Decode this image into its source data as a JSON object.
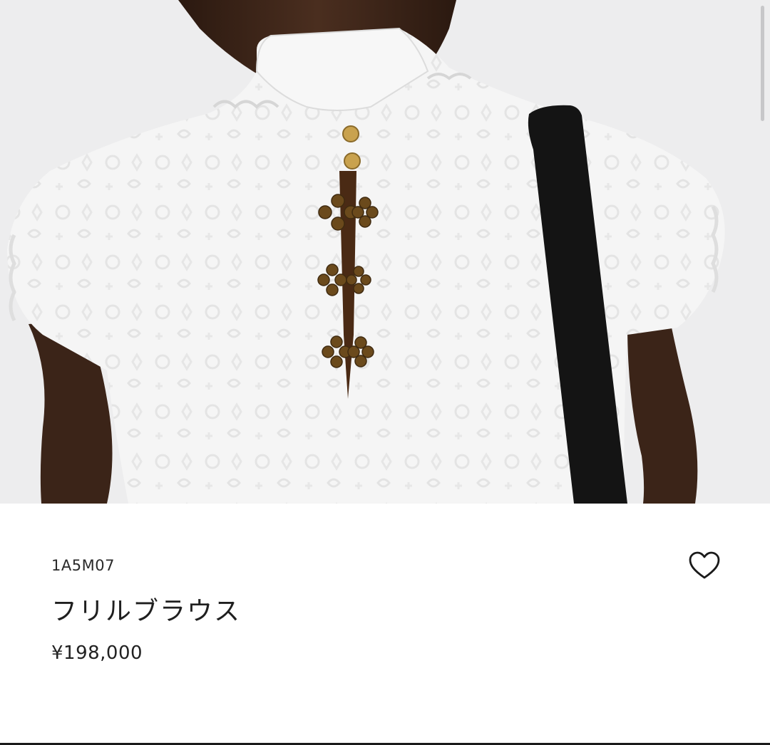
{
  "product": {
    "sku": "1A5M07",
    "name": "フリルブラウス",
    "price": "¥198,000"
  },
  "icons": {
    "favorite": "heart-outline-icon"
  },
  "colors": {
    "background": "#ffffff",
    "photo_backdrop": "#ededee",
    "text": "#1f1f1f",
    "blouse": "#f6f6f6",
    "skin": "#3a2418",
    "bag_strap": "#141414",
    "hardware_gold": "#8a6a2a"
  }
}
